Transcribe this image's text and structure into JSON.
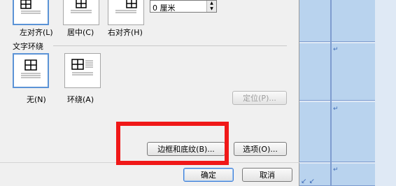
{
  "dialog": {
    "alignment": {
      "options": [
        {
          "label": "左对齐(L)",
          "selected": true
        },
        {
          "label": "居中(C)",
          "selected": false
        },
        {
          "label": "右对齐(H)",
          "selected": false
        }
      ],
      "indent_value": "0 厘米"
    },
    "wrapping": {
      "section_label": "文字环绕",
      "options": [
        {
          "label": "无(N)",
          "selected": true
        },
        {
          "label": "环绕(A)",
          "selected": false
        }
      ],
      "position_button": "定位(P)..."
    },
    "borders_button": "边框和底纹(B)...",
    "options_button": "选项(O)...",
    "ok_button": "确定",
    "cancel_button": "取消"
  },
  "colors": {
    "highlight": "#f01818",
    "selected_border": "#5b93d6",
    "doc_cell": "#b9d3ee"
  },
  "document": {
    "paragraph_mark": "↵",
    "bottom_glyphs": "↙ ↙"
  }
}
